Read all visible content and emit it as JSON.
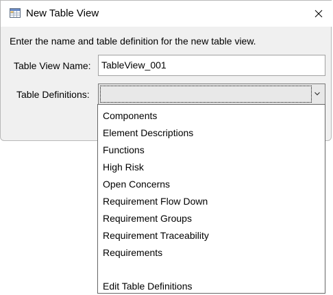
{
  "window": {
    "title": "New Table View",
    "close_glyph": "✕"
  },
  "form": {
    "instruction": "Enter the name and table definition for the new table view.",
    "name_label": "Table View Name:",
    "name_value": "TableView_001",
    "definitions_label": "Table Definitions:",
    "definitions_value": ""
  },
  "dropdown": {
    "items": [
      "Components",
      "Element Descriptions",
      "Functions",
      "High Risk",
      "Open Concerns",
      "Requirement Flow Down",
      "Requirement Groups",
      "Requirement Traceability",
      "Requirements",
      "",
      "Edit Table Definitions"
    ]
  },
  "colors": {
    "dialog_bg": "#f0f0f0",
    "titlebar_bg": "#ffffff",
    "combo_bg": "#e8e8e8",
    "border": "#a0a0a0"
  },
  "icons": {
    "title": "table-view-icon",
    "close": "close-icon",
    "combo": "chevron-down-icon"
  }
}
